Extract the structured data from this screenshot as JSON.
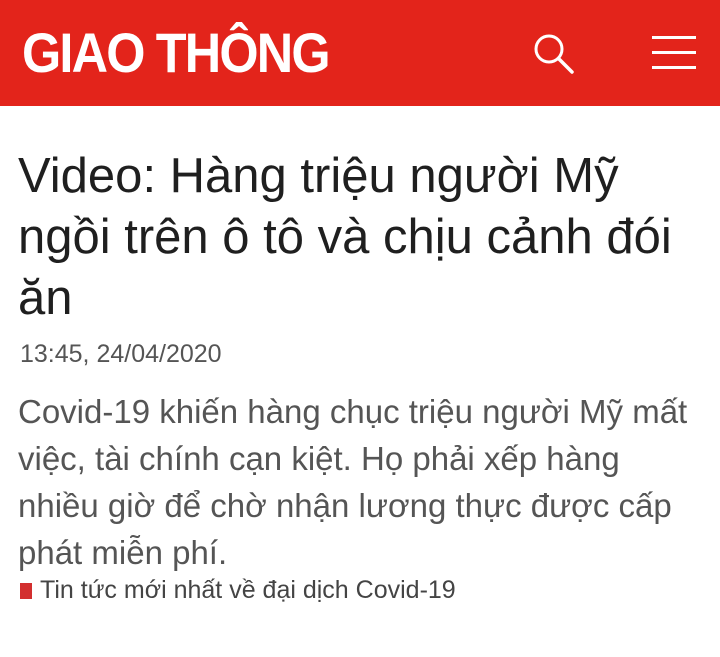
{
  "header": {
    "logo_text": "GIAO THÔNG",
    "background_color": "#e3241b",
    "search_icon": "search-icon",
    "menu_icon": "hamburger-menu-icon"
  },
  "article": {
    "title": "Video: Hàng triệu người Mỹ ngồi trên ô tô và chịu cảnh đói ăn",
    "timestamp": "13:45, 24/04/2020",
    "summary": "Covid-19 khiến hàng chục triệu người Mỹ mất việc, tài chính cạn kiệt. Họ phải xếp hàng nhiều giờ để chờ nhận lương thực được cấp phát miễn phí.",
    "related_link": "Tin tức mới nhất về đại dịch Covid-19",
    "related_bullet_color": "#d32f2f"
  }
}
